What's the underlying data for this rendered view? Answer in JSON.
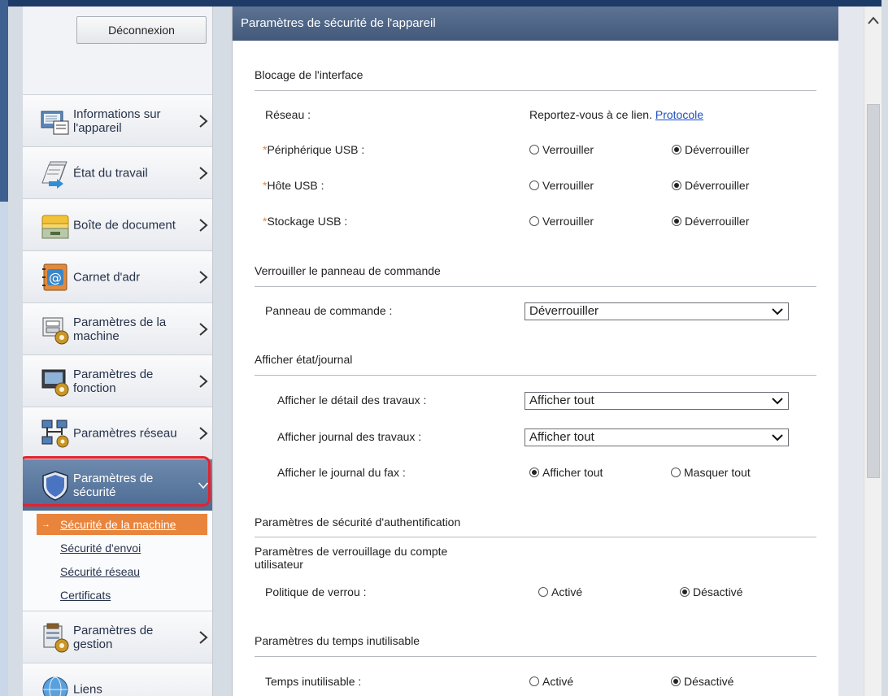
{
  "sidebar": {
    "logout_label": "Déconnexion",
    "items": [
      {
        "label": "Informations sur l'appareil",
        "icon": "device-info-icon"
      },
      {
        "label": "État du travail",
        "icon": "job-status-icon"
      },
      {
        "label": "Boîte de document",
        "icon": "document-box-icon"
      },
      {
        "label": "Carnet d'adr",
        "icon": "address-book-icon"
      },
      {
        "label": "Paramètres de la machine",
        "icon": "machine-settings-icon"
      },
      {
        "label": "Paramètres de fonction",
        "icon": "function-settings-icon"
      },
      {
        "label": "Paramètres réseau",
        "icon": "network-settings-icon"
      },
      {
        "label": "Paramètres de sécurité",
        "icon": "security-shield-icon"
      },
      {
        "label": "Paramètres de gestion",
        "icon": "management-settings-icon"
      },
      {
        "label": "Liens",
        "icon": "links-globe-icon"
      }
    ],
    "security_sub": [
      {
        "label": "Sécurité de la machine"
      },
      {
        "label": "Sécurité d'envoi"
      },
      {
        "label": "Sécurité réseau"
      },
      {
        "label": "Certificats"
      }
    ]
  },
  "main": {
    "title": "Paramètres de sécurité de l'appareil",
    "interface_block": {
      "title": "Blocage de l'interface",
      "network_label": "Réseau :",
      "network_text": "Reportez-vous à ce lien.",
      "network_link": "Protocole",
      "usb_device_label": "Périphérique USB :",
      "usb_host_label": "Hôte USB :",
      "usb_storage_label": "Stockage USB :",
      "lock": "Verrouiller",
      "unlock": "Déverrouiller",
      "required_mark": "*"
    },
    "panel_lock": {
      "title": "Verrouiller le panneau de commande",
      "label": "Panneau de commande :",
      "value": "Déverrouiller"
    },
    "status_log": {
      "title": "Afficher état/journal",
      "job_detail_label": "Afficher le détail des travaux :",
      "job_detail_value": "Afficher tout",
      "job_log_label": "Afficher journal des travaux :",
      "job_log_value": "Afficher tout",
      "fax_log_label": "Afficher le journal du fax :",
      "show_all": "Afficher tout",
      "hide_all": "Masquer tout"
    },
    "auth_security": {
      "title": "Paramètres de sécurité d'authentification",
      "lockout_title": "Paramètres de verrouillage du compte utilisateur",
      "policy_label": "Politique de verrou :",
      "enabled": "Activé",
      "disabled": "Désactivé"
    },
    "idle_time": {
      "title": "Paramètres du temps inutilisable",
      "label": "Temps inutilisable :",
      "enabled": "Activé",
      "disabled": "Désactivé"
    }
  },
  "colors": {
    "header": "#4d6385",
    "accent": "#e8843c",
    "highlight": "#e6212c",
    "link": "#1f4fc0"
  }
}
